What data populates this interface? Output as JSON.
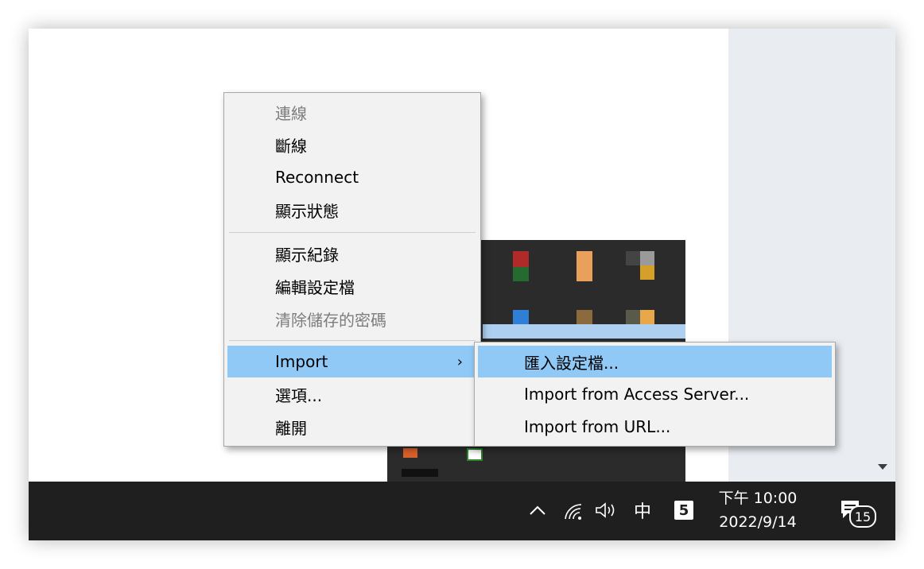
{
  "context_menu": {
    "items": [
      {
        "label": "連線",
        "disabled": true
      },
      {
        "label": "斷線",
        "disabled": false
      },
      {
        "label": "Reconnect",
        "disabled": false
      },
      {
        "label": "顯示狀態",
        "disabled": false
      },
      {
        "label": "顯示紀錄",
        "disabled": false
      },
      {
        "label": "編輯設定檔",
        "disabled": false
      },
      {
        "label": "清除儲存的密碼",
        "disabled": true
      },
      {
        "label": "Import",
        "disabled": false,
        "highlighted": true,
        "has_submenu": true
      },
      {
        "label": "選項...",
        "disabled": false
      },
      {
        "label": "離開",
        "disabled": false
      }
    ]
  },
  "import_submenu": {
    "items": [
      {
        "label": "匯入設定檔...",
        "highlighted": true
      },
      {
        "label": "Import from Access Server..."
      },
      {
        "label": "Import from URL..."
      }
    ]
  },
  "taskbar": {
    "ime_label": "中",
    "clock": {
      "time": "下午 10:00",
      "date": "2022/9/14"
    },
    "notification_count": "15",
    "icons": [
      "chevron-up-icon",
      "wifi-icon",
      "volume-icon",
      "app-icon",
      "notification-icon"
    ]
  },
  "colors": {
    "menu_bg": "#f2f2f2",
    "highlight": "#90c8f6",
    "disabled_text": "#7d7d7d",
    "taskbar_bg": "#1f1f1f"
  }
}
